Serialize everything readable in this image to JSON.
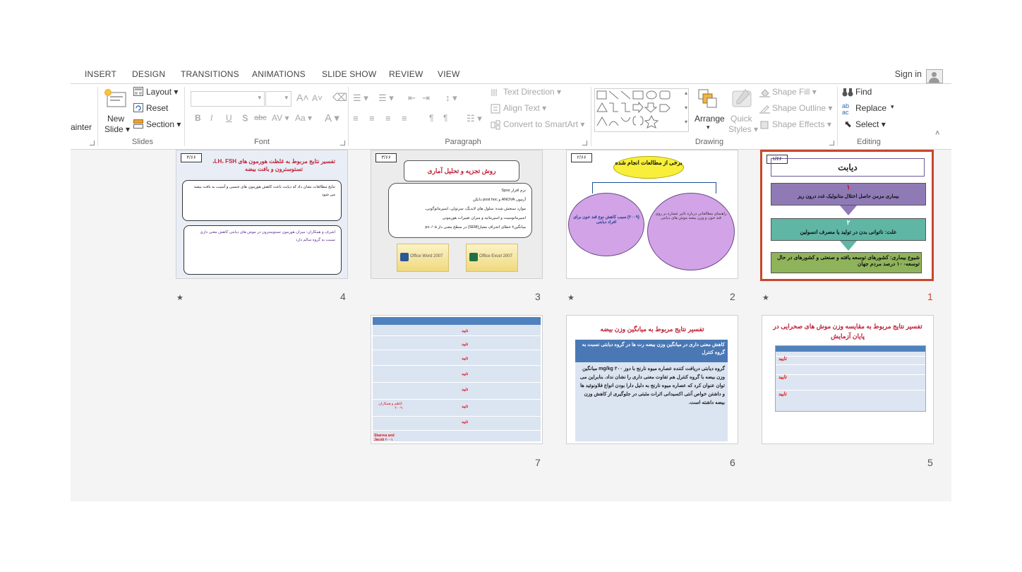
{
  "tabs": [
    "INSERT",
    "DESIGN",
    "TRANSITIONS",
    "ANIMATIONS",
    "SLIDE SHOW",
    "REVIEW",
    "VIEW"
  ],
  "account": {
    "sign_in": "Sign in"
  },
  "ribbon": {
    "clipboard": {
      "painter": "ainter"
    },
    "slides": {
      "new_slide_1": "New",
      "new_slide_2": "Slide",
      "layout": "Layout",
      "reset": "Reset",
      "section": "Section",
      "group": "Slides"
    },
    "font": {
      "group": "Font",
      "bold": "B",
      "italic": "I",
      "underline": "U",
      "shadow": "S",
      "strike": "abc",
      "spacing": "AV",
      "case": "Aa"
    },
    "paragraph": {
      "group": "Paragraph",
      "text_direction": "Text Direction",
      "align_text": "Align Text",
      "convert_smartart": "Convert to SmartArt"
    },
    "drawing": {
      "group": "Drawing",
      "arrange": "Arrange",
      "quick_styles_1": "Quick",
      "quick_styles_2": "Styles",
      "shape_fill": "Shape Fill",
      "shape_outline": "Shape Outline",
      "shape_effects": "Shape Effects"
    },
    "editing": {
      "group": "Editing",
      "find": "Find",
      "replace": "Replace",
      "select": "Select"
    }
  },
  "slides": [
    {
      "number": "1",
      "star": "★",
      "stamp": "۱/۶۶",
      "title": "دیابت",
      "box1_num": "۱",
      "box1": "بیماری مزمن حاصل اختلال متابولیک غدد درون ریز",
      "box2_num": "۲",
      "box2": "علت: ناتوانی بدن در تولید یا مصرف انسولین",
      "box3": "شیوع بیماری: کشورهای توسعه یافته و صنعتی و کشورهای در حال توسعه- ۱۰ درصد مردم جهان"
    },
    {
      "number": "2",
      "star": "★",
      "stamp": "۲/۶۶",
      "title": "برخی از مطالعات انجام شده",
      "left": "(۲۰۰۹) سیب کاهش نوع قند خون برای افراد دیابتی",
      "right": "راهنمای مطالعاتی درباره تاثیر عصاره بر روی قند خون و وزن بیضه موش های دیابتی"
    },
    {
      "number": "3",
      "stamp": "۳/۶۶",
      "title": "روش تجزیه و تحلیل آماری",
      "l1": "نرم افزار Spss",
      "l2": "آزمون ANOVA و post hoc دانکن",
      "l3": "موارد سنجش شده: سلول های لایدیگ، سرتولی، اسپرماتوگونی،",
      "l4": "اسپرماتوسیت و اسپرماتید و میزان تغییرات هورمونی",
      "l5": "میانگین± خطای انحراف معیار(SEM) در سطح معنی دار p≤۰/۰۵",
      "word": "Office Word 2007",
      "excel": "Office Excel 2007"
    },
    {
      "number": "4",
      "star": "★",
      "stamp": "۴/۶۶",
      "title": "تفسیر نتایج مربوط به غلظت هورمون های LH، FSH، تستوسترون و بافت بیضه",
      "p1": "نتایج مطالعات نشان داد که دیابت باعث کاهش هورمون های جنسی و آسیب به بافت بیضه می شود",
      "p2": "اشرف و همکاران: میزان هورمون تستوسترون در موش های دیابتی کاهش معنی داری نسبت به گروه سالم دارد"
    },
    {
      "number": "5",
      "title": "تفسیر نتایج مربوط به مقایسه وزن موش های صحرایی در پایان آزمایش",
      "verdict": "تایید"
    },
    {
      "number": "6",
      "title": "تفسیر نتایج مربوط به میانگین وزن بیضه",
      "box": "کاهش معنی داری در میانگین وزن بیضه رت ها در گروه دیابتی نسبت به گروه کنترل",
      "body": "گروه دیابتی دریافت کننده عصاره میوه نارنج با دوز ۲۰۰ mg/kg میانگین وزن بیضه با گروه کنترل هم تفاوت معنی داری را نشان نداد. بنابراین می توان عنوان کرد که عصاره میوه نارنج به دلیل دارا بودن انواع فلاونوئید ها و داشتن خواص آنتی اکسیدانی اثرات مثبتی در جلوگیری از کاهش وزن بیضه داشته است."
    },
    {
      "number": "7",
      "verdict": "تایید",
      "ref1": "کاظم و همکاران ۲۰۰۹",
      "ref2": "Skarrea and Jacob ۲۰۰۱"
    }
  ]
}
